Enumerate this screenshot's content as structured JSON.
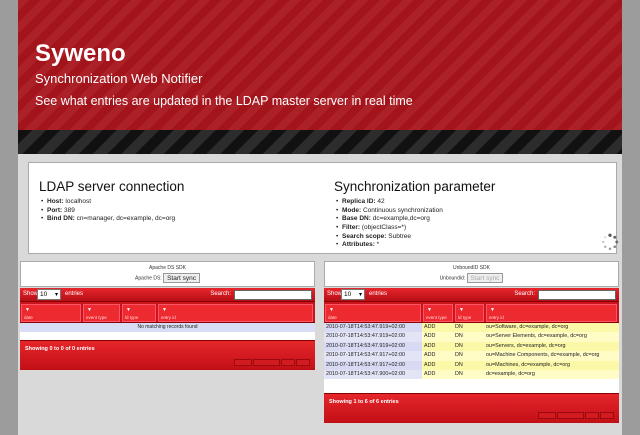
{
  "header": {
    "title": "Syweno",
    "subtitle": "Synchronization Web Notifier",
    "description": "See what entries are updated in the LDAP master server in real time"
  },
  "ldap": {
    "heading": "LDAP server connection",
    "items": [
      {
        "key": "Host:",
        "value": "localhost"
      },
      {
        "key": "Port:",
        "value": "389"
      },
      {
        "key": "Bind DN:",
        "value": "cn=manager, dc=example, dc=org"
      }
    ]
  },
  "sync": {
    "heading": "Synchronization parameter",
    "items": [
      {
        "key": "Replica ID:",
        "value": "42"
      },
      {
        "key": "Mode:",
        "value": "Continuous synchronization"
      },
      {
        "key": "Base DN:",
        "value": "dc=example,dc=org"
      },
      {
        "key": "Filter:",
        "value": "(objectClass=*)"
      },
      {
        "key": "Search scope:",
        "value": "Subtree"
      },
      {
        "key": "Attributes:",
        "value": "*"
      }
    ]
  },
  "apache": {
    "title": "Apache DS SDK",
    "label": "Apache DS:",
    "button": "Start sync",
    "show_label": "Show",
    "show_value": "10",
    "entries_label": "entries",
    "search_label": "Search:",
    "columns": [
      "date",
      "event type",
      "ld type",
      "entry id"
    ],
    "no_records": "No matching records found",
    "showing": "Showing 0 to 0 of 0 entries"
  },
  "unboundid": {
    "title": "UnboundID SDK",
    "label": "Unboundid:",
    "button": "Start sync",
    "show_label": "Show",
    "show_value": "10",
    "entries_label": "entries",
    "search_label": "Search:",
    "columns": [
      "date",
      "event type",
      "ld type",
      "entry id"
    ],
    "rows": [
      {
        "date": "2010-07-18T14:53:47.919+02:00",
        "event": "ADD",
        "type": "DN",
        "entry": "ou=Software, dc=example, dc=org"
      },
      {
        "date": "2010-07-18T14:53:47.919+02:00",
        "event": "ADD",
        "type": "DN",
        "entry": "ou=Server Elements, dc=example, dc=org"
      },
      {
        "date": "2010-07-18T14:53:47.919+02:00",
        "event": "ADD",
        "type": "DN",
        "entry": "ou=Servers, dc=example, dc=org"
      },
      {
        "date": "2010-07-18T14:53:47.917+02:00",
        "event": "ADD",
        "type": "DN",
        "entry": "ou=Machine Components, dc=example, dc=org"
      },
      {
        "date": "2010-07-18T14:53:47.917+02:00",
        "event": "ADD",
        "type": "DN",
        "entry": "ou=Machines, dc=example, dc=org"
      },
      {
        "date": "2010-07-18T14:53:47.900+02:00",
        "event": "ADD",
        "type": "DN",
        "entry": "dc=example, dc=org"
      }
    ],
    "showing": "Showing 1 to 6 of 6 entries"
  }
}
